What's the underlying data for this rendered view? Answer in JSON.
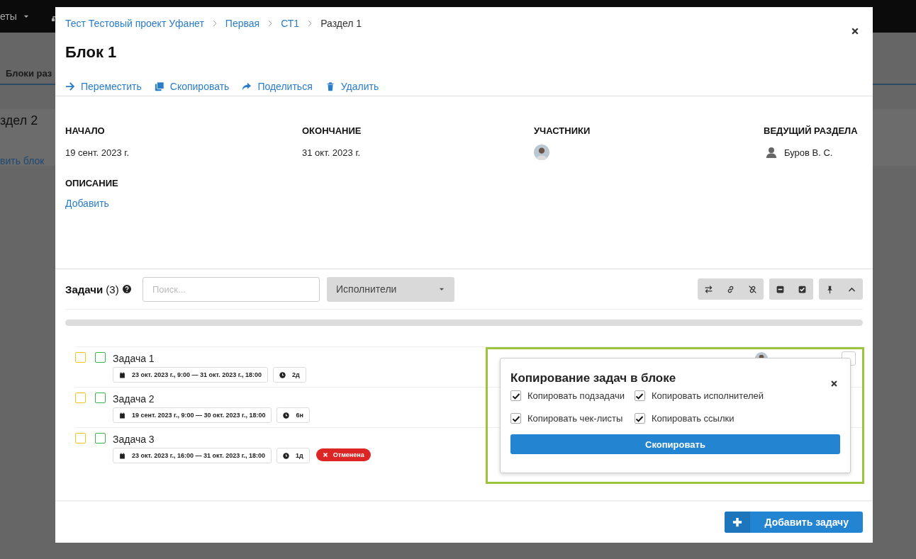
{
  "background": {
    "nav_item": "еты",
    "tab": "Блоки раз",
    "heading": "здел 2",
    "link": "вить блок"
  },
  "modal": {
    "breadcrumbs": [
      {
        "label": "Тест Тестовый проект Уфанет",
        "kind": "link"
      },
      {
        "label": "Первая",
        "kind": "link"
      },
      {
        "label": "СТ1",
        "kind": "link"
      },
      {
        "label": "Раздел 1",
        "kind": "current"
      }
    ],
    "title": "Блок 1",
    "actions": [
      {
        "label": "Переместить",
        "kind": "move"
      },
      {
        "label": "Скопировать",
        "kind": "copy"
      },
      {
        "label": "Поделиться",
        "kind": "share"
      },
      {
        "label": "Удалить",
        "kind": "delete"
      }
    ],
    "fields": [
      {
        "label": "НАЧАЛО",
        "kind": "text",
        "value": "19 сент. 2023 г."
      },
      {
        "label": "ОКОНЧАНИЕ",
        "kind": "text",
        "value": "31 окт. 2023 г."
      },
      {
        "label": "УЧАСТНИКИ",
        "kind": "avatars",
        "people": [
          {
            "kind": "avatar"
          }
        ]
      },
      {
        "label": "ВЕДУЩИЙ РАЗДЕЛА",
        "kind": "person",
        "value": "Буров В. С."
      }
    ],
    "description": {
      "label": "ОПИСАНИЕ",
      "link": "Добавить"
    },
    "tasks": {
      "title": "Задачи",
      "count": "(3)",
      "search_placeholder": "Поиск...",
      "filter": "Исполнители",
      "rows": [
        {
          "name": "Задача 1",
          "dates": "23 окт. 2023 г., 9:00 — 31 окт. 2023 г., 18:00",
          "duration": "2д",
          "checks": [
            {
              "checked": false,
              "color": "#f5c518"
            },
            {
              "checked": false,
              "color": "#3cb44b"
            }
          ],
          "assigned": true
        },
        {
          "name": "Задача 2",
          "dates": "19 сент. 2023 г., 9:00 — 30 окт. 2023 г., 18:00",
          "duration": "6н",
          "checks": [
            {
              "checked": false,
              "color": "#f5c518"
            },
            {
              "checked": false,
              "color": "#3cb44b"
            }
          ]
        },
        {
          "name": "Задача 3",
          "dates": "23 окт. 2023 г., 16:00 — 31 окт. 2023 г., 18:00",
          "duration": "1д",
          "checks": [
            {
              "checked": false,
              "color": "#f5c518"
            },
            {
              "checked": false,
              "color": "#3cb44b"
            }
          ],
          "status": "Отменена"
        }
      ]
    },
    "popover": {
      "title": "Копирование задач в блоке",
      "options": [
        {
          "label": "Копировать подзадачи",
          "checked": true
        },
        {
          "label": "Копировать исполнителей",
          "checked": true
        },
        {
          "label": "Копировать чек-листы",
          "checked": true
        },
        {
          "label": "Копировать ссылки",
          "checked": true
        }
      ],
      "button": "Скопировать"
    },
    "add_button": "Добавить задачу"
  }
}
